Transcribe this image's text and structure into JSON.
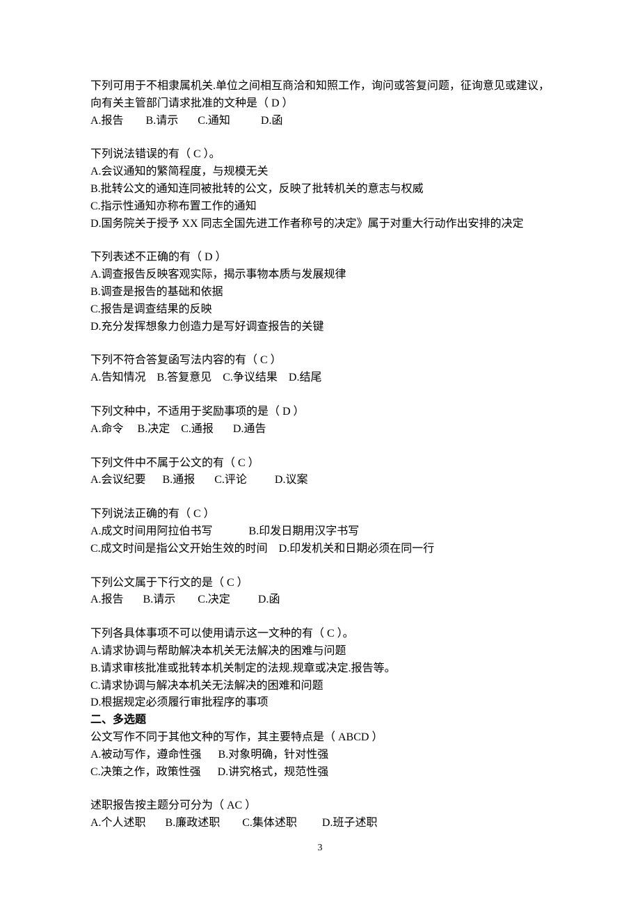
{
  "questions": [
    {
      "stem": "下列可用于不相隶属机关.单位之间相互商洽和知照工作，询问或答复问题，征询意见或建议，向有关主管部门请求批准的文种是（ D ）",
      "opts": [
        "A.报告        B.请示       C.通知           D.函"
      ]
    },
    {
      "stem": "下列说法错误的有（ C  ）。",
      "opts": [
        "A.会议通知的繁简程度，与规模无关",
        "B.批转公文的通知连同被批转的公文，反映了批转机关的意志与权威",
        "C.指示性通知亦称布置工作的通知",
        "D.国务院关于授予 XX 同志全国先进工作者称号的决定》属于对重大行动作出安排的决定"
      ]
    },
    {
      "stem": "下列表述不正确的有（ D ）",
      "opts": [
        "A.调查报告反映客观实际，揭示事物本质与发展规律",
        "B.调查是报告的基础和依据",
        "C.报告是调查结果的反映",
        "D.充分发挥想象力创造力是写好调查报告的关键"
      ]
    },
    {
      "stem": "下列不符合答复函写法内容的有（ C ）",
      "opts": [
        "A.告知情况    B.答复意见    C.争议结果    D.结尾"
      ]
    },
    {
      "stem": "下列文种中，不适用于奖励事项的是（ D  ）",
      "opts": [
        "A.命令     B.决定    C.通报       D.通告"
      ]
    },
    {
      "stem": "下列文件中不属于公文的有（ C  ）",
      "opts": [
        "A.会议纪要      B.通报       C.评论          D.议案"
      ]
    },
    {
      "stem": "下列说法正确的有（ C ）",
      "opts": [
        "A.成文时间用阿拉伯书写             B.印发日期用汉字书写",
        "C.成文时间是指公文开始生效的时间    D.印发机关和日期必须在同一行"
      ]
    },
    {
      "stem": "下列公文属于下行文的是（ C  ）",
      "opts": [
        "A.报告       B.请示        C.决定          D.函"
      ]
    },
    {
      "stem": "下列各具体事项不可以使用请示这一文种的有（ C  ）。",
      "opts": [
        "A.请求协调与帮助解决本机关无法解决的困难与问题",
        "B.请求审核批准或批转本机关制定的法规.规章或决定.报告等。",
        "C.请求协调与解决本机关无法解决的困难和问题",
        "D.根据规定必须履行审批程序的事项"
      ]
    }
  ],
  "section2_title": "二、多选题",
  "section2_questions": [
    {
      "stem": "公文写作不同于其他文种的写作，其主要特点是（ ABCD ）",
      "opts": [
        "A.被动写作，遵命性强      B.对象明确，针对性强",
        "C.决策之作，政策性强      D.讲究格式，规范性强"
      ]
    },
    {
      "stem": "述职报告按主题分可分为（ AC ）",
      "opts": [
        "A.个人述职       B.廉政述职        C.集体述职         D.班子述职"
      ]
    }
  ],
  "page_number": "3"
}
